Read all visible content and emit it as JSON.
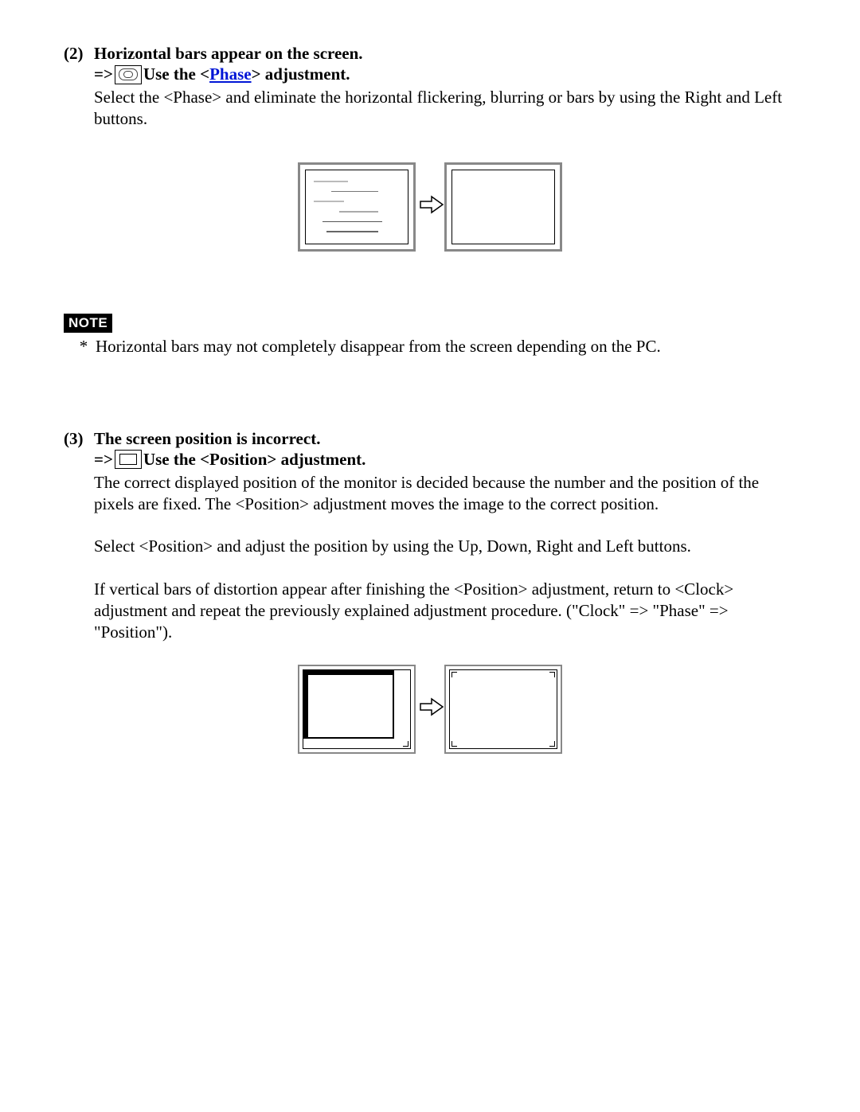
{
  "section2": {
    "number": "(2)",
    "title": "Horizontal bars appear on the screen.",
    "arrow": "=>",
    "use_pre": "Use the <",
    "link": "Phase",
    "use_post": "> adjustment.",
    "body": "Select the <Phase> and eliminate the horizontal flickering, blurring or bars by using the Right and Left buttons."
  },
  "note": {
    "label": "NOTE",
    "star": "*",
    "text": "Horizontal bars may not completely disappear from the screen depending on the PC."
  },
  "section3": {
    "number": "(3)",
    "title": "The screen position is incorrect.",
    "arrow": "=>",
    "use_text": "Use the <Position> adjustment.",
    "p1": "The correct displayed position of the monitor is decided because the number and the position of the pixels are fixed. The <Position> adjustment moves the image to the correct position.",
    "p2": "Select <Position> and adjust the position by using the Up, Down, Right and Left buttons.",
    "p3": "If vertical bars of distortion appear after finishing the <Position> adjustment, return to <Clock> adjustment and repeat the previously explained adjustment procedure. (\"Clock\" => \"Phase\" => \"Position\")."
  }
}
